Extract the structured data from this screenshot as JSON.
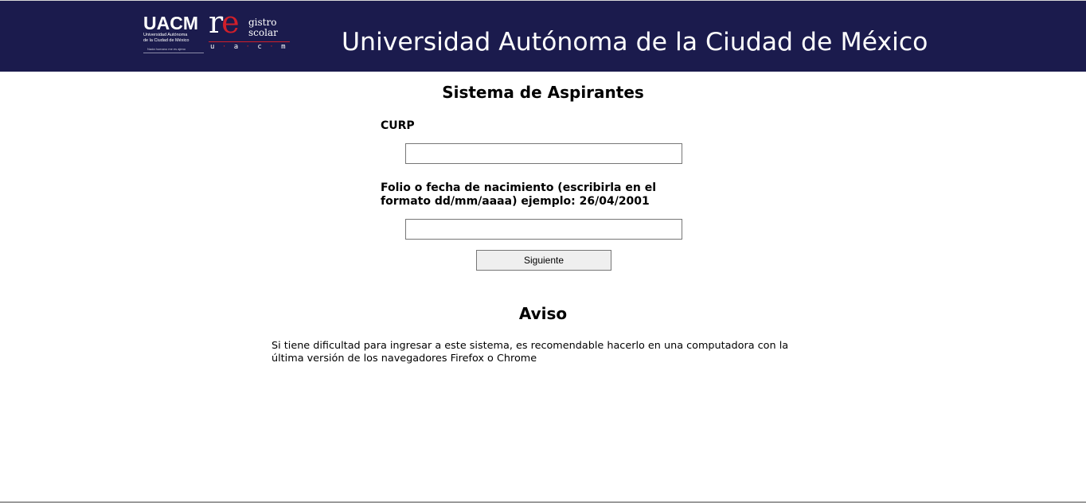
{
  "header": {
    "title": "Universidad Autónoma de la Ciudad de México",
    "background_color": "#1b1b4d",
    "uacm_logo": {
      "word": "UACM",
      "subtitle_line1": "Universidad Autónoma",
      "subtitle_line2": "de la Ciudad de México",
      "motto": "Nada humano me es ajeno"
    },
    "registro_logo": {
      "re_r": "r",
      "re_e": "e",
      "word1": "gistro",
      "word2": "scolar",
      "letters": [
        "u",
        "a",
        "c",
        "m"
      ],
      "accent_color": "#d11f2a"
    }
  },
  "main": {
    "title": "Sistema de Aspirantes",
    "curp_label": "CURP",
    "curp_value": "",
    "folio_label": "Folio o fecha de nacimiento (escribirla en el formato dd/mm/aaaa) ejemplo: 26/04/2001",
    "folio_value": "",
    "next_button": "Siguiente"
  },
  "aviso": {
    "title": "Aviso",
    "text": "Si tiene dificultad para ingresar a este sistema, es recomendable hacerlo en una computadora con la última versión de los navegadores Firefox o Chrome"
  }
}
